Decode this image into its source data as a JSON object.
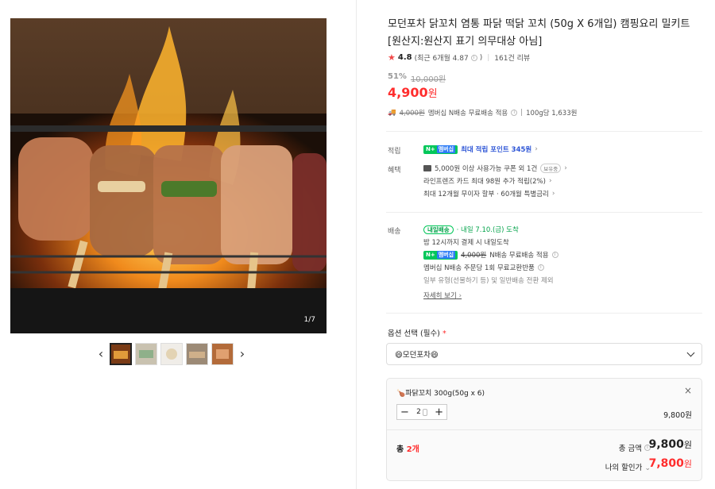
{
  "product": {
    "title_line1": "모던포차 닭꼬치 염통 파닭 떡닭 꼬치 (50g X 6개입) 캠핑요리 밀키트",
    "title_line2": "[원산지:원산지 표기 의무대상 아님]",
    "rating": "4.8",
    "rating_recent": "(최근 6개월 4.87",
    "review_count": "161건 리뷰",
    "discount_rate": "51%",
    "original_price": "10,000원",
    "sale_price": "4,900",
    "sale_won": "원"
  },
  "gallery": {
    "counter": "1/7",
    "thumb_count": 5
  },
  "shipping_line": {
    "orig_fee": "4,000원",
    "text": "멤버십 N배송 무료배송 적용",
    "unit_price": "100g당 1,633원"
  },
  "benefits": {
    "accrual_label": "적립",
    "accrual_badge": "N+",
    "accrual_badge2": "멤버십",
    "accrual_text": "최대 적립 포인트 345원",
    "perks_label": "혜택",
    "coupon_text": "5,000원 이상 사용가능 쿠폰 외 1건",
    "coupon_badge": "보유중",
    "card_text": "라인프렌즈 카드 최대 98원 추가 적립(2%)",
    "installment_text": "최대 12개월 무이자 할부 · 60개월 특별금리"
  },
  "delivery": {
    "label": "배송",
    "tomorrow_badge": "내일배송",
    "arrival_text": "· 내일 7.10.(금) 도착",
    "cutoff_text": "밤 12시까지 결제 시 내일도착",
    "member_badge": "N+",
    "member_badge2": "멤버십",
    "fee_orig": "4,000원",
    "fee_text": "N배송 무료배송 적용",
    "exchange_text": "멤버십 N배송 주문당 1회 무료교환반품",
    "exception_text": "일부 유형(선물하기 등) 및 일반배송 전환 제외",
    "detail_link": "자세히 보기"
  },
  "option": {
    "label": "옵션 선택 (필수)",
    "required_mark": "*",
    "selected_value": "😄모던포차😄"
  },
  "selected_item": {
    "name": "🍗파닭꼬치 300g(50g x 6)",
    "quantity": "2",
    "price": "9,800원"
  },
  "totals": {
    "count_prefix": "총 ",
    "count": "2개",
    "total_label": "총 금액",
    "total_price": "9,800",
    "total_won": "원",
    "my_label": "나의 할인가",
    "my_price": "7,800",
    "my_won": "원"
  },
  "colors": {
    "accent_red": "#ff2d2d",
    "naver_green": "#03c75a",
    "benefit_blue": "#2d55d6"
  }
}
